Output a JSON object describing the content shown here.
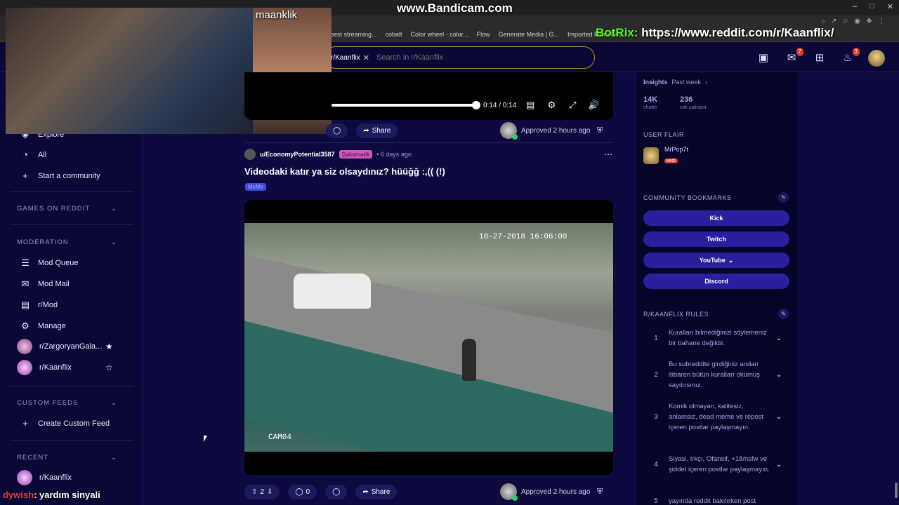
{
  "overlay": {
    "bandicam": "www.Bandicam.com",
    "botrix_brand": "BotRix:",
    "botrix_url": "https://www.reddit.com/r/Kaanflix/",
    "cam2_name": "maanklik",
    "chat_nick": "dywish",
    "chat_msg": ": yardım sinyali"
  },
  "bookmarks": [
    "best streaming...",
    "cobalt",
    "Color wheel - color...",
    "Flow",
    "Generate Media | G...",
    "Imported From Fire..."
  ],
  "search": {
    "chip": "r/Kaanflix",
    "placeholder": "Search in r/Kaanflix"
  },
  "header": {
    "chat_badge": "7",
    "notif_badge": "3"
  },
  "sidebar": {
    "explore": "Explore",
    "all": "All",
    "start_community": "Start a community",
    "games_section": "GAMES ON REDDIT",
    "moderation_section": "MODERATION",
    "mod_queue": "Mod Queue",
    "mod_mail": "Mod Mail",
    "r_mod": "r/Mod",
    "manage": "Manage",
    "sub1": "r/ZargoryanGala...",
    "sub2": "r/Kaanflix",
    "custom_feeds_section": "CUSTOM FEEDS",
    "create_feed": "Create Custom Feed",
    "recent_section": "RECENT",
    "recent1": "r/Kaanflix"
  },
  "player": {
    "time": "0:14 / 0:14",
    "progress": 1.0
  },
  "post1": {
    "share": "Share",
    "approved": "Approved 2 hours ago"
  },
  "post2": {
    "user": "u/EconomyPotential3587",
    "user_flair": "Şakamatik",
    "age": "• 6 days ago",
    "title": "Videodaki katır ya siz olsaydınız? hüüğğ :,(( (!)",
    "post_flair": "MeMe",
    "timestamp": "10-27-2018 16:06:00",
    "cam_label": "CAM04",
    "upvotes": "2",
    "comments": "0",
    "share": "Share",
    "approved": "Approved 2 hours ago"
  },
  "right": {
    "insights": "Insights",
    "period": "Past week",
    "stat1_num": "14K",
    "stat1_label": "chatto",
    "stat2_num": "236",
    "stat2_label": "cok calisiyor",
    "user_flair_head": "USER FLAIR",
    "flair_name": "MrPop7t",
    "flair_tag": "kedi",
    "bookmarks_head": "COMMUNITY BOOKMARKS",
    "bm_kick": "Kick",
    "bm_twitch": "Twitch",
    "bm_youtube": "YouTube",
    "bm_discord": "Discord",
    "rules_head": "R/KAANFLIX RULES",
    "rules": [
      {
        "n": "1",
        "t": "Kuralları bilmediğinizi söylemeniz bir bahane değildir."
      },
      {
        "n": "2",
        "t": "Bu subreddite girdiğiniz andan itibaren bütün kuralları okumuş sayılırsınız."
      },
      {
        "n": "3",
        "t": "Komik olmayan, kalitesiz, anlamsız, dead meme ve repost içeren postlar paylaşmayın."
      },
      {
        "n": "4",
        "t": "Siyasi, Irkçı, Ofansif, +18/nsfw ve şiddet içeren postlar paylaşmayın."
      },
      {
        "n": "5",
        "t": "yayında reddit bakılırken post"
      }
    ]
  }
}
